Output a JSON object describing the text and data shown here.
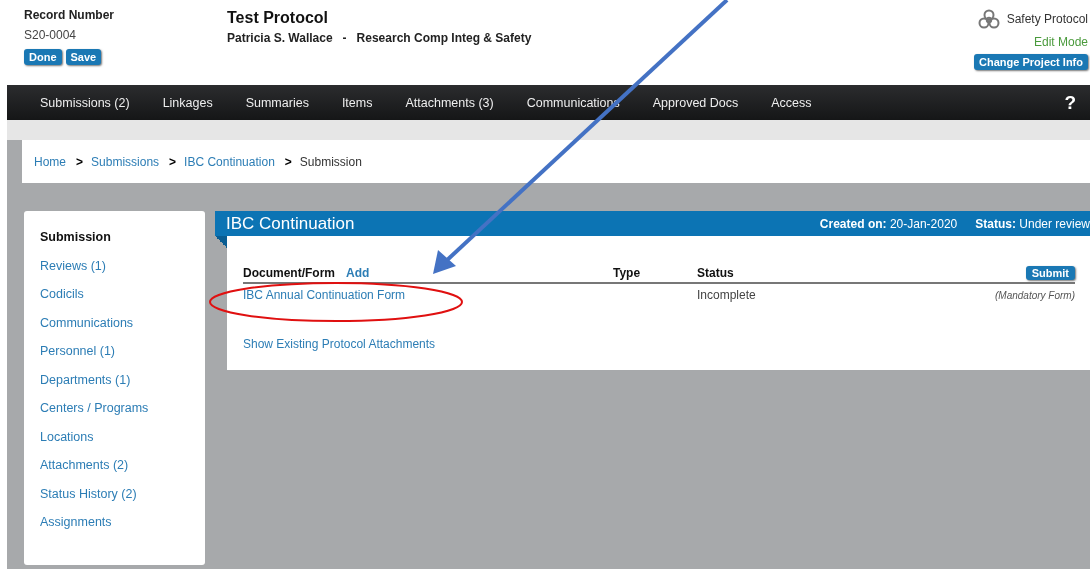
{
  "record": {
    "label": "Record Number",
    "number": "S20-0004",
    "buttons": [
      "Done",
      "Save"
    ]
  },
  "protocol": {
    "title": "Test Protocol",
    "owner": "Patricia S. Wallace",
    "separator": "-",
    "department": "Research Comp Integ & Safety"
  },
  "project": {
    "type": "Safety Protocol",
    "mode": "Edit Mode",
    "button": "Change Project Info"
  },
  "nav": {
    "items": [
      "Submissions (2)",
      "Linkages",
      "Summaries",
      "Items",
      "Attachments (3)",
      "Communications",
      "Approved Docs",
      "Access"
    ],
    "help": "?"
  },
  "breadcrumb": [
    {
      "label": "Home",
      "link": true
    },
    {
      "label": "Submissions",
      "link": true,
      "sep": ">"
    },
    {
      "label": "IBC Continuation",
      "link": true,
      "sep": ">"
    },
    {
      "label": "Submission",
      "link": false,
      "sep": ">"
    }
  ],
  "sidebar": {
    "items": [
      {
        "label": "Submission",
        "selected": true
      },
      {
        "label": "Reviews (1)",
        "selected": false
      },
      {
        "label": "Codicils",
        "selected": false
      },
      {
        "label": "Communications",
        "selected": false
      },
      {
        "label": "Personnel (1)",
        "selected": false
      },
      {
        "label": "Departments (1)",
        "selected": false
      },
      {
        "label": "Centers / Programs",
        "selected": false
      },
      {
        "label": "Locations",
        "selected": false
      },
      {
        "label": "Attachments (2)",
        "selected": false
      },
      {
        "label": "Status History (2)",
        "selected": false
      },
      {
        "label": "Assignments",
        "selected": false
      }
    ]
  },
  "panel": {
    "title": "IBC Continuation",
    "created_label": "Created on:",
    "created": "20-Jan-2020",
    "status_label": "Status:",
    "status": "Under review",
    "table": {
      "columns": [
        "Document/Form",
        "Type",
        "Status"
      ],
      "add": "Add",
      "submit": "Submit",
      "rows": [
        {
          "document": "IBC Annual Continuation Form",
          "status": "Incomplete",
          "note": "(Mandatory Form)"
        }
      ]
    },
    "link": "Show Existing Protocol Attachments"
  },
  "annotations": {
    "arrow": true,
    "highlight_ellipse": true
  }
}
